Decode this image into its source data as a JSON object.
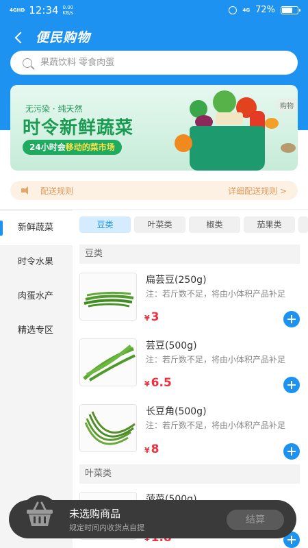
{
  "status_bar": {
    "network": "4GHD",
    "time": "12:34",
    "speed_value": "0.00",
    "speed_unit": "KB/s",
    "signal": "4G",
    "battery": "72%",
    "battery_level": 0.72
  },
  "header": {
    "title": "便民购物"
  },
  "search": {
    "placeholder": "果蔬饮料 零食肉蛋"
  },
  "banner": {
    "tagline": "无污染 · 纯天然",
    "headline": "时令新鲜蔬菜",
    "pill_prefix": "24小时会",
    "pill_highlight": "移动的菜市场",
    "corner_label": "购物"
  },
  "delivery": {
    "label": "配送规则",
    "detail_link": "详细配送规则 >"
  },
  "sidebar": {
    "items": [
      {
        "label": "新鲜蔬菜",
        "active": true
      },
      {
        "label": "时令水果",
        "active": false
      },
      {
        "label": "肉蛋水产",
        "active": false
      },
      {
        "label": "精选专区",
        "active": false
      }
    ]
  },
  "subtabs": [
    {
      "label": "豆类",
      "active": true
    },
    {
      "label": "叶菜类",
      "active": false
    },
    {
      "label": "椒类",
      "active": false
    },
    {
      "label": "茄果类",
      "active": false
    }
  ],
  "sections": [
    {
      "title": "豆类"
    },
    {
      "title": "叶菜类"
    }
  ],
  "products": [
    {
      "name": "扁芸豆(250g)",
      "note": "注：若斤数不足，将由小体积产品补足",
      "currency": "¥",
      "price": "3"
    },
    {
      "name": "芸豆(500g)",
      "note": "注：若斤数不足，将由小体积产品补足",
      "currency": "¥",
      "price": "6.5"
    },
    {
      "name": "长豆角(500g)",
      "note": "注：若斤数不足，将由小体积产品补足",
      "currency": "¥",
      "price": "8"
    },
    {
      "name": "菠菜(500g)",
      "note": "",
      "currency": "¥",
      "price": "1.8"
    }
  ],
  "cart": {
    "title": "未选购商品",
    "subtitle": "规定时间内收货点自提",
    "checkout_label": "结算"
  },
  "colors": {
    "primary": "#1d92f0",
    "price": "#f0303e",
    "banner_green": "#1b9b52",
    "rules_bg": "#fdf1e4",
    "rules_text": "#e09a5a"
  }
}
